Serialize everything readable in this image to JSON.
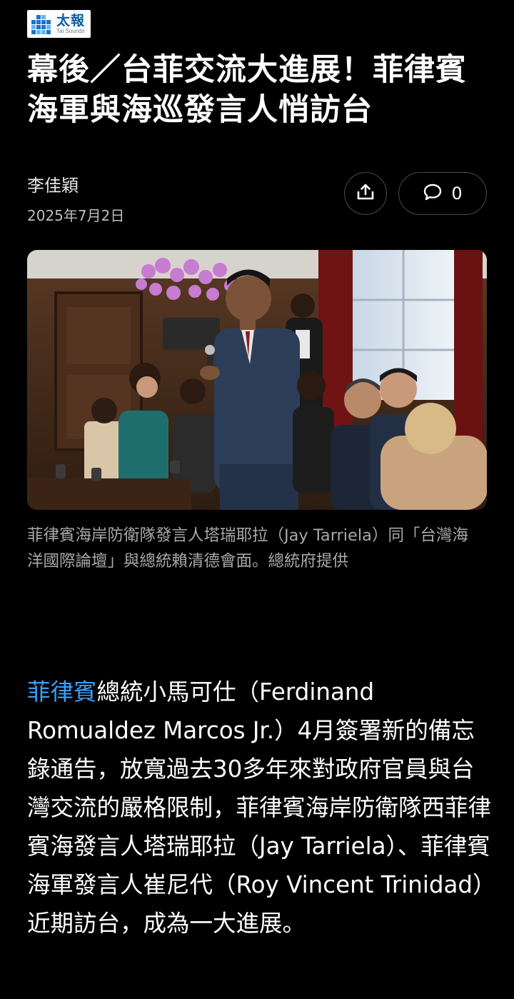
{
  "logo": {
    "cn": "太報",
    "en": "Tai Sounds"
  },
  "article": {
    "title": "幕後／台菲交流大進展！菲律賓海軍與海巡發言人悄訪台",
    "author": "李佳穎",
    "date": "2025年7月2日",
    "comment_count": "0",
    "photo_caption": "菲律賓海岸防衛隊發言人塔瑞耶拉（Jay Tarriela）同「台灣海洋國際論壇」與總統賴清德會面。總統府提供",
    "body_link": "菲律賓",
    "body_text": "總統小馬可仕（Ferdinand Romualdez Marcos Jr.）4月簽署新的備忘錄通告，放寬過去30多年來對政府官員與台灣交流的嚴格限制，菲律賓海岸防衛隊西菲律賓海發言人塔瑞耶拉（Jay Tarriela）、菲律賓海軍發言人崔尼代（Roy Vincent Trinidad）近期訪台，成為一大進展。"
  },
  "icons": {
    "share": "share-icon",
    "comment": "comment-bubble-icon"
  },
  "colors": {
    "background": "#000000",
    "link": "#3aa0f5",
    "logo_blue": "#0b5fa8"
  }
}
